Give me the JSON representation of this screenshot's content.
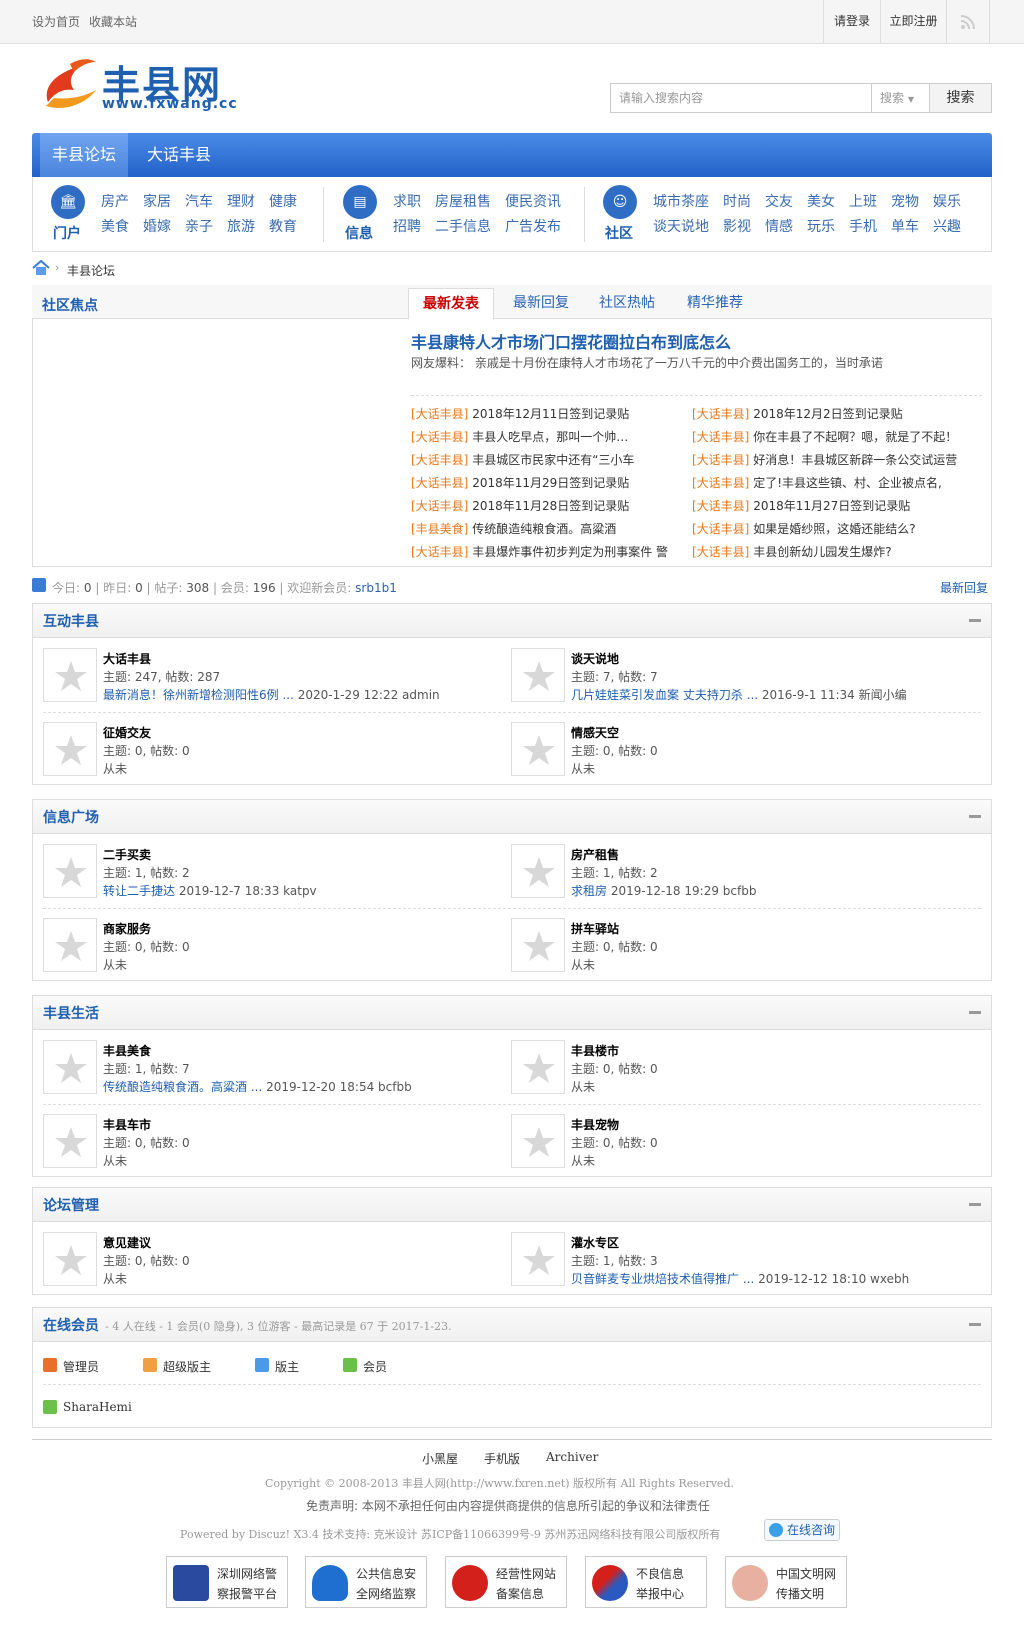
{
  "topbar": {
    "home": "设为首页",
    "fav": "收藏本站",
    "login": "请登录",
    "register": "立即注册"
  },
  "logo": {
    "name": "丰县网",
    "url": "www.fxwang.cc"
  },
  "search": {
    "placeholder": "请输入搜索内容",
    "type": "搜索",
    "button": "搜索"
  },
  "nav": {
    "tabs": [
      "丰县论坛",
      "大话丰县"
    ]
  },
  "subnav": {
    "groups": [
      {
        "label": "门户",
        "links": [
          [
            "房产",
            "家居",
            "汽车",
            "理财",
            "健康"
          ],
          [
            "美食",
            "婚嫁",
            "亲子",
            "旅游",
            "教育"
          ]
        ]
      },
      {
        "label": "信息",
        "links": [
          [
            "求职",
            "房屋租售",
            "便民资讯"
          ],
          [
            "招聘",
            "二手信息",
            "广告发布"
          ]
        ]
      },
      {
        "label": "社区",
        "links": [
          [
            "城市茶座",
            "时尚",
            "交友",
            "美女",
            "上班",
            "宠物",
            "娱乐"
          ],
          [
            "谈天说地",
            "影视",
            "情感",
            "玩乐",
            "手机",
            "单车",
            "兴趣"
          ]
        ]
      }
    ]
  },
  "breadcrumb": {
    "current": "丰县论坛"
  },
  "focus": {
    "title": "社区焦点",
    "tabs": [
      "最新发表",
      "最新回复",
      "社区热帖",
      "精华推荐"
    ],
    "headline": "丰县康特人才市场门口摆花圈拉白布到底怎么",
    "summary": "网友爆料： 亲戚是十月份在康特人才市场花了一万八千元的中介费出国务工的，当时承诺",
    "left": [
      {
        "tag": "[大话丰县]",
        "title": "2018年12月11日签到记录贴"
      },
      {
        "tag": "[大话丰县]",
        "title": "丰县人吃早点，那叫一个帅…"
      },
      {
        "tag": "[大话丰县]",
        "title": "丰县城区市民家中还有“三小车"
      },
      {
        "tag": "[大话丰县]",
        "title": "2018年11月29日签到记录贴"
      },
      {
        "tag": "[大话丰县]",
        "title": "2018年11月28日签到记录贴"
      },
      {
        "tag": "[丰县美食]",
        "title": "传统酿造纯粮食酒。高粱酒"
      },
      {
        "tag": "[大话丰县]",
        "title": "丰县爆炸事件初步判定为刑事案件 警"
      }
    ],
    "right": [
      {
        "tag": "[大话丰县]",
        "title": "2018年12月2日签到记录贴"
      },
      {
        "tag": "[大话丰县]",
        "title": "你在丰县了不起啊？嗯，就是了不起！"
      },
      {
        "tag": "[大话丰县]",
        "title": "好消息！丰县城区新辟一条公交试运营"
      },
      {
        "tag": "[大话丰县]",
        "title": "定了!丰县这些镇、村、企业被点名,"
      },
      {
        "tag": "[大话丰县]",
        "title": "2018年11月27日签到记录贴"
      },
      {
        "tag": "[大话丰县]",
        "title": "如果是婚纱照，这婚还能结么?"
      },
      {
        "tag": "[大话丰县]",
        "title": "丰县创新幼儿园发生爆炸?"
      }
    ]
  },
  "stats": {
    "today_l": "今日:",
    "today": "0",
    "yest_l": "昨日:",
    "yest": "0",
    "posts_l": "帖子:",
    "posts": "308",
    "members_l": "会员:",
    "members": "196",
    "welcome": "欢迎新会员:",
    "newest": "srb1b1",
    "latest_reply": "最新回复"
  },
  "sections": [
    {
      "title": "互动丰县",
      "forums": [
        {
          "name": "大话丰县",
          "meta": "主题: 247, 帖数: 287",
          "last_link": "最新消息！徐州新增检测阳性6例 ...",
          "last_info": " 2020-1-29 12:22 admin"
        },
        {
          "name": "谈天说地",
          "meta": "主题: 7, 帖数: 7",
          "last_link": "几片娃娃菜引发血案 丈夫持刀杀 ...",
          "last_info": " 2016-9-1 11:34 新闻小编"
        },
        {
          "name": "征婚交友",
          "meta": "主题: 0, 帖数: 0",
          "last_link": "",
          "last_info": "从未"
        },
        {
          "name": "情感天空",
          "meta": "主题: 0, 帖数: 0",
          "last_link": "",
          "last_info": "从未"
        }
      ]
    },
    {
      "title": "信息广场",
      "forums": [
        {
          "name": "二手买卖",
          "meta": "主题: 1, 帖数: 2",
          "last_link": "转让二手捷达",
          "last_info": " 2019-12-7 18:33 katpv"
        },
        {
          "name": "房产租售",
          "meta": "主题: 1, 帖数: 2",
          "last_link": "求租房",
          "last_info": " 2019-12-18 19:29 bcfbb"
        },
        {
          "name": "商家服务",
          "meta": "主题: 0, 帖数: 0",
          "last_link": "",
          "last_info": "从未"
        },
        {
          "name": "拼车驿站",
          "meta": "主题: 0, 帖数: 0",
          "last_link": "",
          "last_info": "从未"
        }
      ]
    },
    {
      "title": "丰县生活",
      "forums": [
        {
          "name": "丰县美食",
          "meta": "主题: 1, 帖数: 7",
          "last_link": "传统酿造纯粮食酒。高粱酒 ...",
          "last_info": " 2019-12-20 18:54 bcfbb"
        },
        {
          "name": "丰县楼市",
          "meta": "主题: 0, 帖数: 0",
          "last_link": "",
          "last_info": "从未"
        },
        {
          "name": "丰县车市",
          "meta": "主题: 0, 帖数: 0",
          "last_link": "",
          "last_info": "从未"
        },
        {
          "name": "丰县宠物",
          "meta": "主题: 0, 帖数: 0",
          "last_link": "",
          "last_info": "从未"
        }
      ]
    },
    {
      "title": "论坛管理",
      "forums": [
        {
          "name": "意见建议",
          "meta": "主题: 0, 帖数: 0",
          "last_link": "",
          "last_info": "从未"
        },
        {
          "name": "灌水专区",
          "meta": "主题: 1, 帖数: 3",
          "last_link": "贝音鲜麦专业烘焙技术值得推广 ...",
          "last_info": " 2019-12-12 18:10 wxebh"
        }
      ]
    }
  ],
  "online": {
    "title": "在线会员",
    "summary": "- 4 人在线 - 1 会员(0 隐身), 3 位游客 - 最高记录是 67 于 2017-1-23.",
    "legend": [
      "管理员",
      "超级版主",
      "版主",
      "会员"
    ],
    "user": "SharaHemi"
  },
  "footer": {
    "links": [
      "小黑屋",
      "手机版",
      "Archiver"
    ],
    "copyright": "Copyright © 2008-2013 丰县人网(http://www.fxren.net) 版权所有 All Rights Reserved.",
    "disclaimer": "免责声明: 本网不承担任何由内容提供商提供的信息所引起的争议和法律责任",
    "powered": "Powered by Discuz! X3.4  技术支持: 克米设计  苏ICP备11066399号-9 苏州苏迅网络科技有限公司版权所有",
    "consult": "在线咨询",
    "badges": [
      [
        "深圳网络警",
        "察报警平台"
      ],
      [
        "公共信息安",
        "全网络监察"
      ],
      [
        "经营性网站",
        "备案信息"
      ],
      [
        "不良信息",
        "举报中心"
      ],
      [
        "中国文明网",
        "传播文明"
      ]
    ]
  }
}
